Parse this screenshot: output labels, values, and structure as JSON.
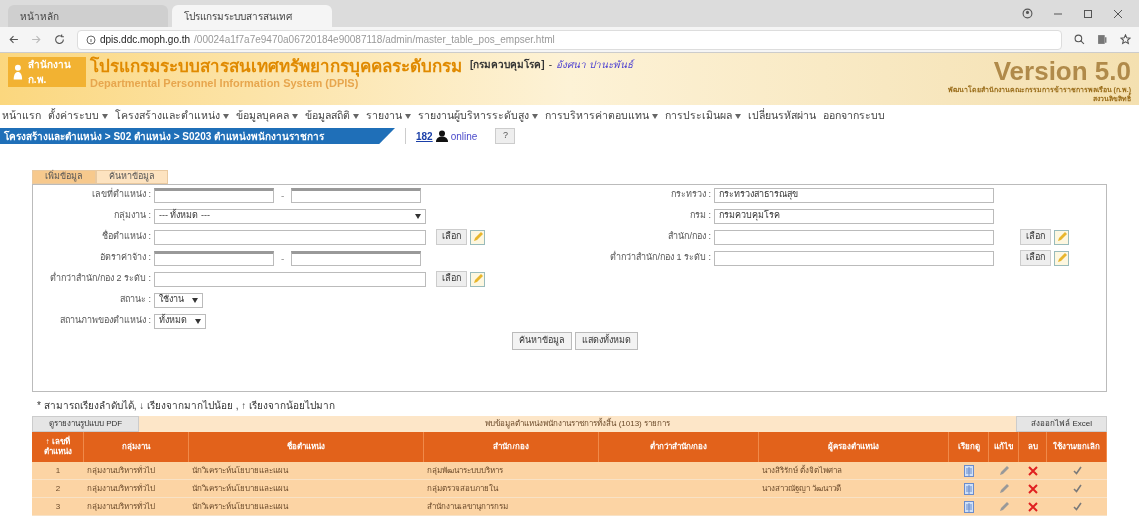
{
  "browser": {
    "tabs": [
      {
        "label": "หน้าหลัก",
        "selected": false
      },
      {
        "label": "โปรแกรมระบบสารสนเทศ",
        "selected": true
      }
    ],
    "url_host": "dpis.ddc.moph.go.th",
    "url_path": "/00024a1f7a7e9470a06720184e90087118/admin/master_table_pos_empser.html"
  },
  "header": {
    "logo_text": "สำนักงาน ก.พ.",
    "title": "โปรแกรมระบบสารสนเทศทรัพยากรบุคคลระดับกรม",
    "subtitle": "Departmental Personnel Information System (DPIS)",
    "org": "[กรมควบคุมโรค]",
    "separator": "-",
    "user": "อังศนา ปานะพันธ์",
    "version": "Version 5.0",
    "version_note": "พัฒนาโดยสำนักงานคณะกรรมการข้าราชการพลเรือน (ก.พ.)",
    "version_note2": "สงวนลิขสิทธิ์"
  },
  "menu": [
    {
      "label": "หน้าแรก",
      "dropdown": false
    },
    {
      "label": "ตั้งค่าระบบ",
      "dropdown": true
    },
    {
      "label": "โครงสร้างและตำแหน่ง",
      "dropdown": true
    },
    {
      "label": "ข้อมูลบุคคล",
      "dropdown": true
    },
    {
      "label": "ข้อมูลสถิติ",
      "dropdown": true
    },
    {
      "label": "รายงาน",
      "dropdown": true
    },
    {
      "label": "รายงานผู้บริหารระดับสูง",
      "dropdown": true
    },
    {
      "label": "การบริหารค่าตอบแทน",
      "dropdown": true
    },
    {
      "label": "การประเมินผล",
      "dropdown": true
    },
    {
      "label": "เปลี่ยนรหัสผ่าน",
      "dropdown": false
    },
    {
      "label": "ออกจากระบบ",
      "dropdown": false
    }
  ],
  "breadcrumb": "โครงสร้างและตำแหน่ง > S02 ตำแหน่ง > S0203 ตำแหน่งพนักงานราชการ",
  "online": {
    "count": "182",
    "label": "online"
  },
  "help": "?",
  "form_tabs": [
    {
      "label": "เพิ่มข้อมูล",
      "selected": true
    },
    {
      "label": "ค้นหาข้อมูล",
      "selected": false
    }
  ],
  "form_left": [
    {
      "label": "เลขที่ตำแหน่ง :",
      "kind": "range",
      "separator": "-"
    },
    {
      "label": "กลุ่มงาน :",
      "kind": "select",
      "value": "--- ทั้งหมด ---"
    },
    {
      "label": "ชื่อตำแหน่ง :",
      "kind": "picker",
      "button": "เลือก"
    },
    {
      "label": "อัตราค่าจ้าง :",
      "kind": "range",
      "separator": "-"
    },
    {
      "label": "ต่ำกว่าสำนัก/กอง 2 ระดับ :",
      "kind": "picker",
      "button": "เลือก"
    },
    {
      "label": "สถานะ :",
      "kind": "small_select",
      "value": "ใช้งาน"
    },
    {
      "label": "สถานภาพของตำแหน่ง :",
      "kind": "small_select",
      "value": "ทั้งหมด"
    }
  ],
  "form_right": [
    {
      "label": "กระทรวง :",
      "kind": "text",
      "value": "กระทรวงสาธารณสุข"
    },
    {
      "label": "กรม :",
      "kind": "text",
      "value": "กรมควบคุมโรค"
    },
    {
      "label": "สำนัก/กอง :",
      "kind": "picker",
      "button": "เลือก"
    },
    {
      "label": "ต่ำกว่าสำนัก/กอง 1 ระดับ :",
      "kind": "picker",
      "button": "เลือก"
    }
  ],
  "form_buttons": [
    "ค้นหาข้อมูล",
    "แสดงทั้งหมด"
  ],
  "sort_note": "* สามารถเรียงลำดับได้, ↓ เรียงจากมากไปน้อย , ↑ เรียงจากน้อยไปมาก",
  "pdf_button": "ดูรายงานรูปแบบ PDF",
  "result_text": "พบข้อมูลตำแหน่งพนักงานราชการทั้งสิ้น (1013) รายการ",
  "excel_button": "ส่งออกไฟล์ Excel",
  "table": {
    "columns": [
      "↑ เลขที่ตำแหน่ง",
      "กลุ่มงาน",
      "ชื่อตำแหน่ง",
      "สำนัก/กอง",
      "ต่ำกว่าสำนัก/กอง",
      "ผู้ครองตำแหน่ง",
      "เรียกดู",
      "แก้ไข",
      "ลบ",
      "ใช้งาน/ยกเลิก"
    ],
    "rows": [
      {
        "cells": [
          "1",
          "กลุ่มงานบริหารทั่วไป",
          "นักวิเคราะห์นโยบายและแผน",
          "กลุ่มพัฒนาระบบบริหาร",
          "",
          "นางสิริรักษ์ ตั้งจิตไพศาล"
        ],
        "active": true
      },
      {
        "cells": [
          "2",
          "กลุ่มงานบริหารทั่วไป",
          "นักวิเคราะห์นโยบายและแผน",
          "กลุ่มตรวจสอบภายใน",
          "",
          "นางสาวณัฐญา วัฒนาวดี"
        ],
        "active": true
      },
      {
        "cells": [
          "3",
          "กลุ่มงานบริหารทั่วไป",
          "นักวิเคราะห์นโยบายและแผน",
          "สำนักงานเลขานุการกรม",
          "",
          ""
        ],
        "active": true
      }
    ]
  }
}
